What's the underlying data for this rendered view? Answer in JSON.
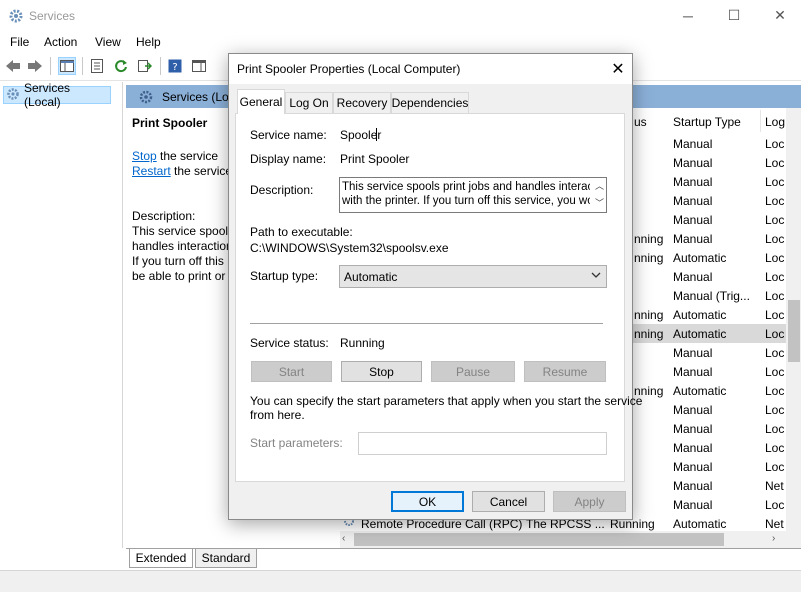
{
  "window": {
    "title": "Services"
  },
  "menu": [
    "File",
    "Action",
    "View",
    "Help"
  ],
  "tree": {
    "root": "Services (Local)"
  },
  "header": {
    "title": "Services (Local)"
  },
  "detail": {
    "name": "Print Spooler",
    "stop_link": "Stop",
    "stop_suffix": " the service",
    "restart_link": "Restart",
    "restart_suffix": " the service",
    "desc_label": "Description:",
    "desc_lines": [
      "This service spools",
      "handles interaction",
      "If you turn off this",
      "be able to print or"
    ]
  },
  "list": {
    "columns": {
      "status": "us",
      "startup": "Startup Type",
      "logon": "Log"
    },
    "rows": [
      {
        "status": "",
        "startup": "Manual",
        "logon": "Loc"
      },
      {
        "status": "",
        "startup": "Manual",
        "logon": "Loc"
      },
      {
        "status": "",
        "startup": "Manual",
        "logon": "Loc"
      },
      {
        "status": "",
        "startup": "Manual",
        "logon": "Loc"
      },
      {
        "status": "",
        "startup": "Manual",
        "logon": "Loc"
      },
      {
        "status": "nning",
        "startup": "Manual",
        "logon": "Loc"
      },
      {
        "status": "nning",
        "startup": "Automatic",
        "logon": "Loc"
      },
      {
        "status": "",
        "startup": "Manual",
        "logon": "Loc"
      },
      {
        "status": "",
        "startup": "Manual (Trig...",
        "logon": "Loc"
      },
      {
        "status": "nning",
        "startup": "Automatic",
        "logon": "Loc"
      },
      {
        "status": "nning",
        "startup": "Automatic",
        "logon": "Loc"
      },
      {
        "status": "",
        "startup": "Manual",
        "logon": "Loc"
      },
      {
        "status": "",
        "startup": "Manual",
        "logon": "Loc"
      },
      {
        "status": "nning",
        "startup": "Automatic",
        "logon": "Loc"
      },
      {
        "status": "",
        "startup": "Manual",
        "logon": "Loc"
      },
      {
        "status": "",
        "startup": "Manual",
        "logon": "Loc"
      },
      {
        "status": "",
        "startup": "Manual",
        "logon": "Loc"
      },
      {
        "status": "",
        "startup": "Manual",
        "logon": "Loc"
      },
      {
        "status": "",
        "startup": "Manual",
        "logon": "Net"
      },
      {
        "status": "",
        "startup": "Manual",
        "logon": "Loc"
      }
    ],
    "last_row": {
      "name": "Remote Procedure Call (RPC)",
      "desc": "The RPCSS ...",
      "status": "Running",
      "startup": "Automatic",
      "logon": "Net"
    }
  },
  "bottom_tabs": [
    "Extended",
    "Standard"
  ],
  "dialog": {
    "title": "Print Spooler Properties (Local Computer)",
    "tabs": [
      "General",
      "Log On",
      "Recovery",
      "Dependencies"
    ],
    "service_name_label": "Service name:",
    "service_name_value": "Spooler",
    "display_name_label": "Display name:",
    "display_name_value": "Print Spooler",
    "description_label": "Description:",
    "description_line1": "This service spools print jobs and handles interaction",
    "description_line2": "with the printer.  If you turn off this service, you won't",
    "path_label": "Path to executable:",
    "path_value": "C:\\WINDOWS\\System32\\spoolsv.exe",
    "startup_label": "Startup type:",
    "startup_value": "Automatic",
    "status_label": "Service status:",
    "status_value": "Running",
    "btn_start": "Start",
    "btn_stop": "Stop",
    "btn_pause": "Pause",
    "btn_resume": "Resume",
    "help_text_line1": "You can specify the start parameters that apply when you start the service",
    "help_text_line2": "from here.",
    "start_params_label": "Start parameters:",
    "start_params_value": "",
    "btn_ok": "OK",
    "btn_cancel": "Cancel",
    "btn_apply": "Apply"
  }
}
